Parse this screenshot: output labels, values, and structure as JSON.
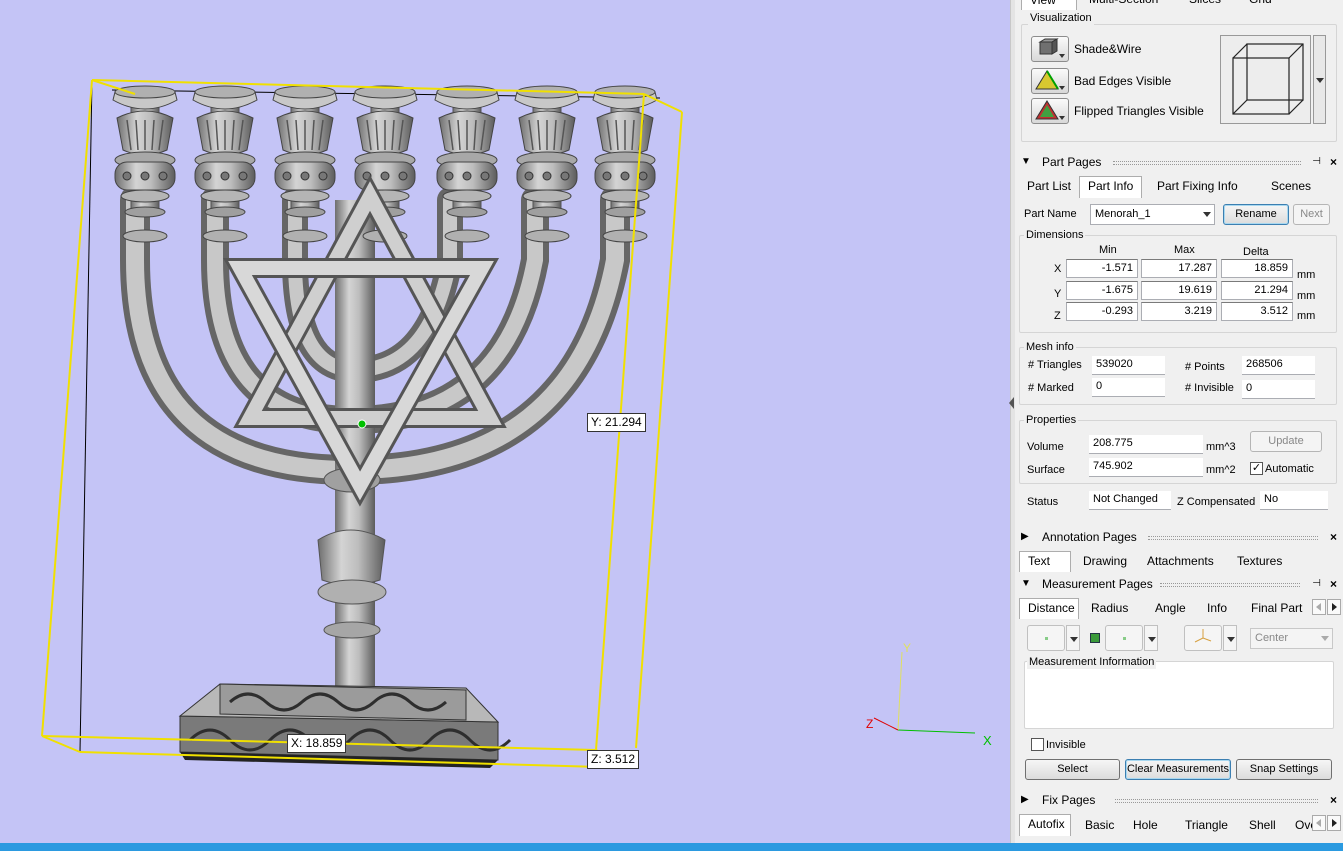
{
  "viewport": {
    "labels": {
      "x": "X: 18.859",
      "y": "Y: 21.294",
      "z": "Z: 3.512"
    },
    "axes": {
      "x": "X",
      "y": "Y",
      "z": "Z"
    },
    "colors": {
      "background": "#c4c4f6",
      "bbox": "#f0e000",
      "model": "#9a9a9a",
      "axis_x": "#00c000",
      "axis_y": "#e0e060",
      "axis_z": "#e00000"
    }
  },
  "view_tabs": [
    "View",
    "Multi-Section",
    "Slices",
    "Grid"
  ],
  "visualization": {
    "title": "Visualization",
    "items": [
      {
        "label": "Shade&Wire",
        "icon": "shade-wire-icon"
      },
      {
        "label": "Bad Edges Visible",
        "icon": "bad-edges-icon"
      },
      {
        "label": "Flipped Triangles Visible",
        "icon": "flipped-triangles-icon"
      }
    ]
  },
  "part_pages": {
    "title": "Part Pages",
    "tabs": [
      "Part List",
      "Part Info",
      "Part Fixing Info",
      "Scenes"
    ],
    "part_name_label": "Part Name",
    "part_name_value": "Menorah_1",
    "rename_label": "Rename",
    "next_label": "Next",
    "dimensions": {
      "title": "Dimensions",
      "headers": [
        "Min",
        "Max",
        "Delta"
      ],
      "rows": [
        {
          "axis": "X",
          "min": "-1.571",
          "max": "17.287",
          "delta": "18.859",
          "unit": "mm"
        },
        {
          "axis": "Y",
          "min": "-1.675",
          "max": "19.619",
          "delta": "21.294",
          "unit": "mm"
        },
        {
          "axis": "Z",
          "min": "-0.293",
          "max": "3.219",
          "delta": "3.512",
          "unit": "mm"
        }
      ]
    },
    "mesh_info": {
      "title": "Mesh info",
      "triangles_label": "# Triangles",
      "triangles": "539020",
      "points_label": "# Points",
      "points": "268506",
      "marked_label": "# Marked",
      "marked": "0",
      "invisible_label": "# Invisible",
      "invisible": "0"
    },
    "properties": {
      "title": "Properties",
      "volume_label": "Volume",
      "volume": "208.775",
      "volume_unit": "mm^3",
      "update_label": "Update",
      "surface_label": "Surface",
      "surface": "745.902",
      "surface_unit": "mm^2",
      "automatic_label": "Automatic",
      "automatic_checked": "✓"
    },
    "status_label": "Status",
    "status": "Not Changed",
    "zcomp_label": "Z Compensated",
    "zcomp": "No"
  },
  "annotation_pages": {
    "title": "Annotation Pages",
    "tabs": [
      "Text",
      "Drawing",
      "Attachments",
      "Textures"
    ]
  },
  "measurement_pages": {
    "title": "Measurement Pages",
    "tabs": [
      "Distance",
      "Radius",
      "Angle",
      "Info",
      "Final Part"
    ],
    "center_option": "Center",
    "info_title": "Measurement Information",
    "invisible_label": "Invisible",
    "select_label": "Select",
    "clear_label": "Clear Measurements",
    "snap_label": "Snap Settings"
  },
  "fix_pages": {
    "title": "Fix Pages",
    "tabs": [
      "Autofix",
      "Basic",
      "Hole",
      "Triangle",
      "Shell",
      "Over"
    ]
  }
}
